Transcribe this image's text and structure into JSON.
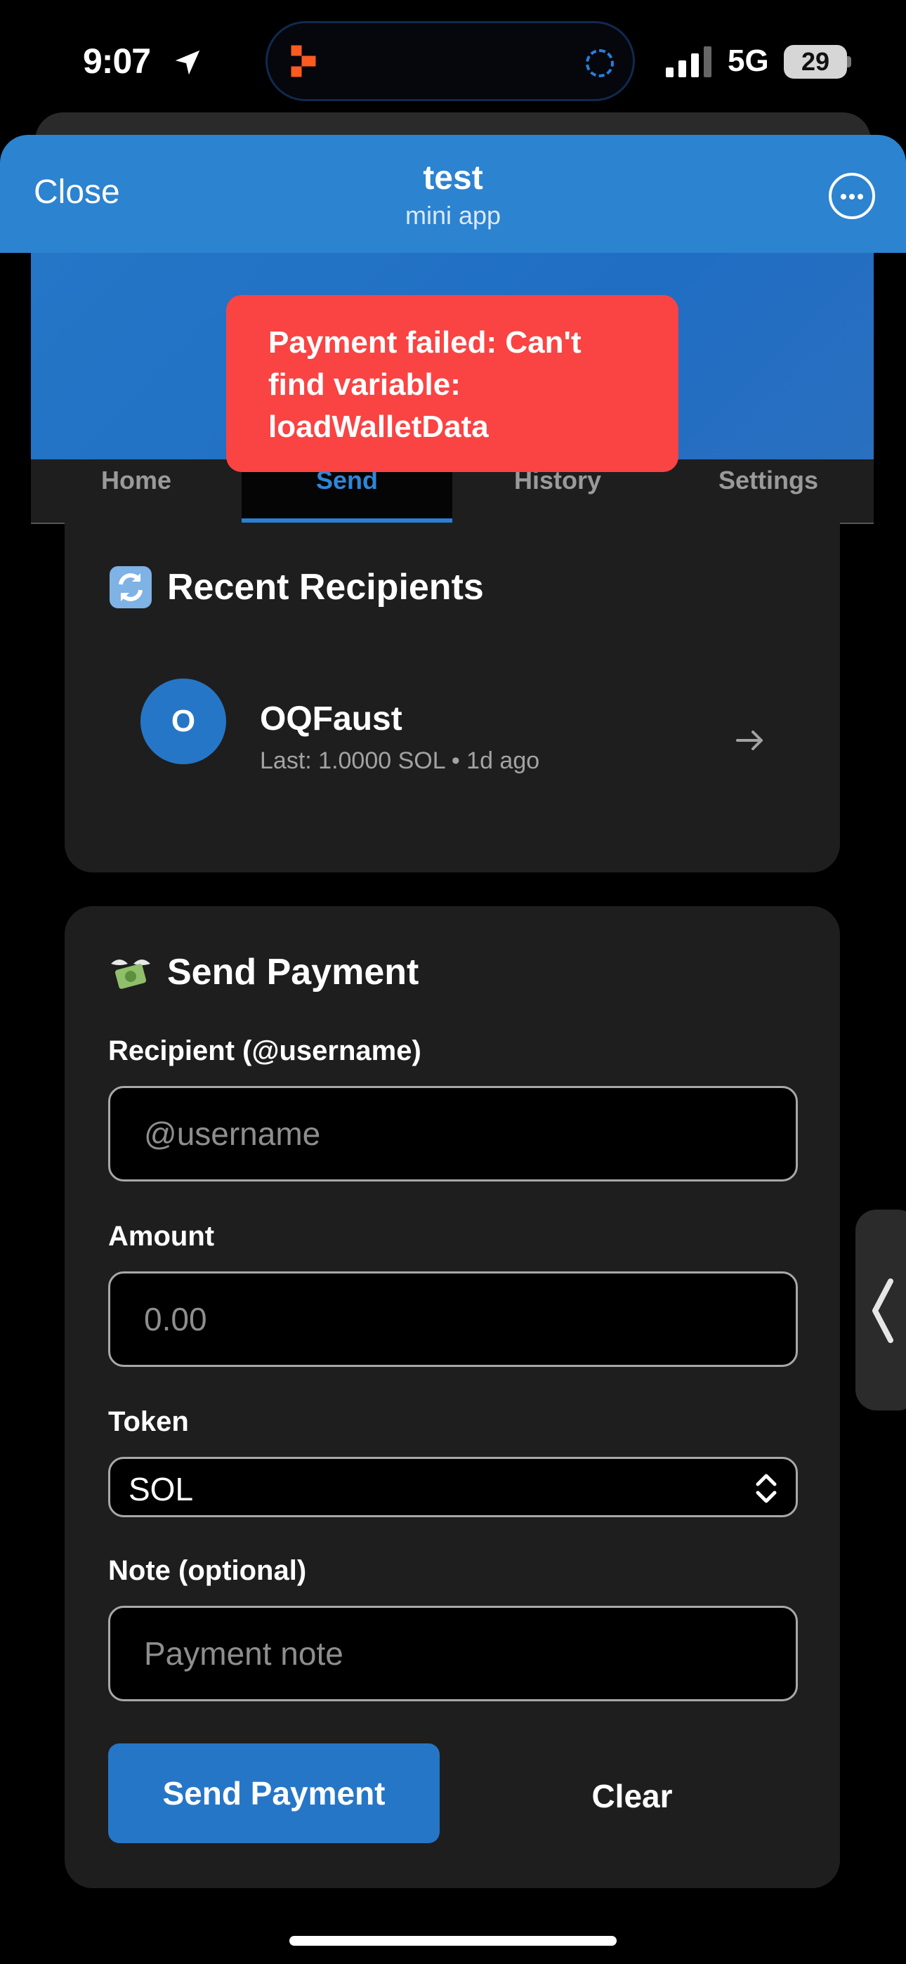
{
  "status_bar": {
    "time": "9:07",
    "network": "5G",
    "battery": "29"
  },
  "header": {
    "close_label": "Close",
    "title": "test",
    "subtitle": "mini app"
  },
  "toast": {
    "message": "Payment failed: Can't find variable: loadWalletData"
  },
  "tabs": [
    {
      "label": "Home",
      "active": false
    },
    {
      "label": "Send",
      "active": true
    },
    {
      "label": "History",
      "active": false
    },
    {
      "label": "Settings",
      "active": false
    }
  ],
  "recent": {
    "title": "Recent Recipients",
    "icon": "arrows-cycle-icon",
    "items": [
      {
        "initial": "O",
        "name": "OQFaust",
        "meta": "Last: 1.0000 SOL • 1d ago"
      }
    ]
  },
  "send": {
    "title": "Send Payment",
    "icon": "money-wings-icon",
    "recipient_label": "Recipient (@username)",
    "recipient_placeholder": "@username",
    "amount_label": "Amount",
    "amount_placeholder": "0.00",
    "token_label": "Token",
    "token_value": "SOL",
    "note_label": "Note (optional)",
    "note_placeholder": "Payment note",
    "send_label": "Send Payment",
    "clear_label": "Clear"
  },
  "colors": {
    "accent": "#2676c7",
    "header": "#2c83d0",
    "toast": "#fa4343",
    "card": "#1e1e1e"
  }
}
